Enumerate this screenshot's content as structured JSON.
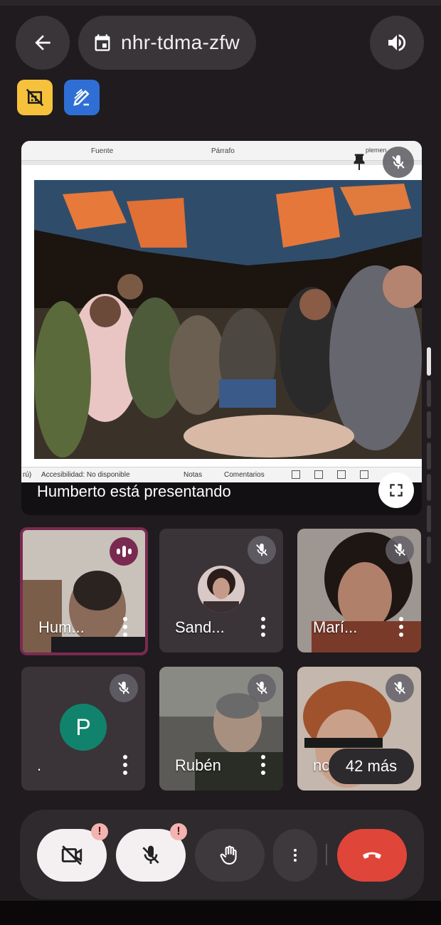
{
  "meeting": {
    "code": "nhr-tdma-zfw",
    "icons": {
      "back": "arrow-left-icon",
      "calendar": "calendar-icon",
      "speaker": "volume-icon"
    }
  },
  "badges": [
    {
      "icon": "no-recording-icon",
      "color": "#f6c23d"
    },
    {
      "icon": "pencil-edit-icon",
      "color": "#2f6fd5"
    }
  ],
  "presentation": {
    "presenter_text": "Humberto está presentando",
    "document": {
      "ribbon_labels": [
        "Fuente",
        "Párrafo",
        "plemen"
      ],
      "status_items": [
        "rú)",
        "Accesibilidad: No disponible",
        "Notas",
        "Comentarios"
      ]
    }
  },
  "participants": [
    {
      "name": "Hum...",
      "speaking": true,
      "muted": false
    },
    {
      "name": "Sand...",
      "speaking": false,
      "muted": true
    },
    {
      "name": "Marí...",
      "speaking": false,
      "muted": true
    },
    {
      "name": ".",
      "avatar_letter": "P",
      "speaking": false,
      "muted": true
    },
    {
      "name": "Rubén",
      "speaking": false,
      "muted": true
    },
    {
      "name": "nor",
      "speaking": false,
      "muted": true
    }
  ],
  "more_participants": "42 más",
  "controls": {
    "camera": {
      "icon": "camera-off-icon",
      "alert": "!"
    },
    "mic": {
      "icon": "mic-off-icon",
      "alert": "!"
    },
    "hand": {
      "icon": "raise-hand-icon"
    },
    "more": {
      "icon": "more-vert-icon"
    },
    "end": {
      "icon": "end-call-icon"
    }
  },
  "colors": {
    "accent_speaking": "#7a2a50",
    "end_call": "#e0453a",
    "avatar_p": "#11836d"
  }
}
